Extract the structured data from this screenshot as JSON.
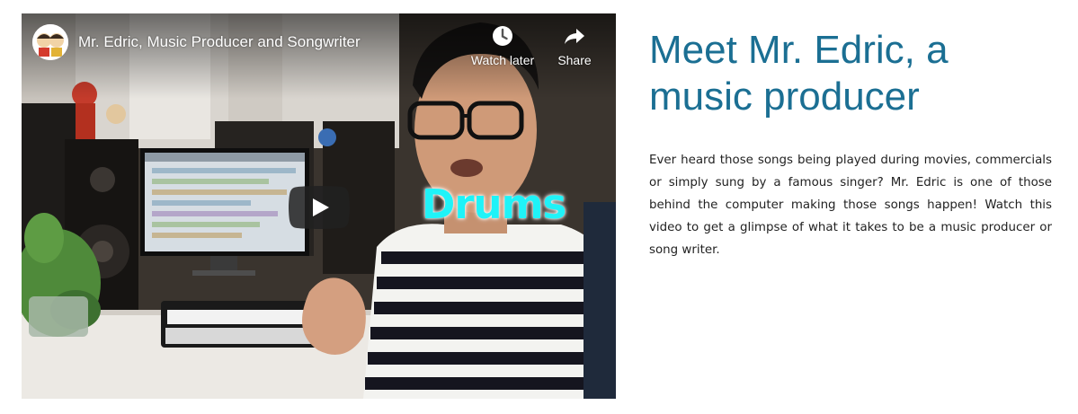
{
  "video": {
    "title": "Mr. Edric, Music Producer and Songwriter",
    "overlay_caption": "Drums",
    "actions": {
      "watch_later": {
        "label": "Watch later",
        "icon": "clock-icon"
      },
      "share": {
        "label": "Share",
        "icon": "share-arrow-icon"
      }
    },
    "play_icon": "play-icon",
    "play_color": "#212121"
  },
  "article": {
    "heading": "Meet Mr. Edric, a music producer",
    "body": "Ever heard those songs being played during movies, commercials or simply sung by a famous singer? Mr. Edric is one of those behind the computer making those songs happen! Watch this video to get a glimpse of what it takes to be a music producer or song writer.",
    "heading_color": "#1b6f93",
    "text_color": "#222222"
  }
}
